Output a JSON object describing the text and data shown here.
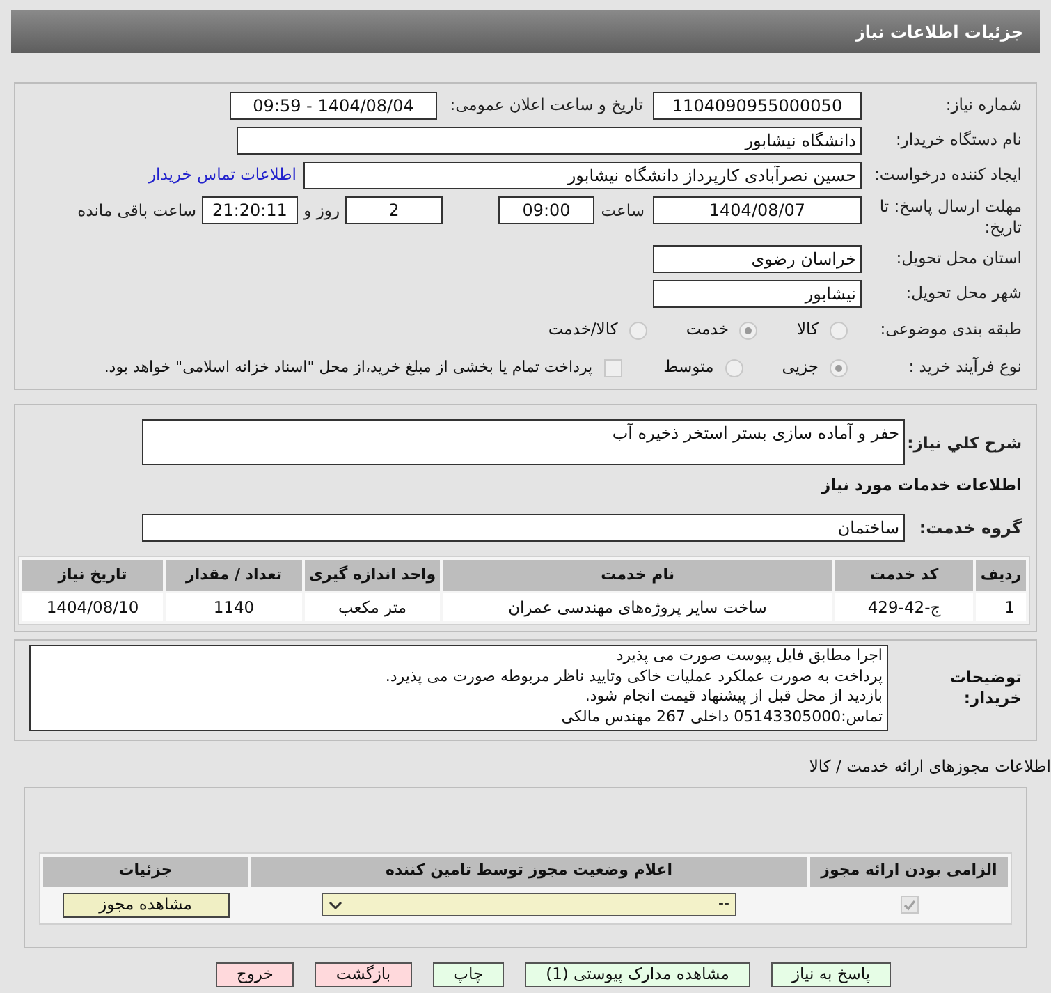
{
  "header": {
    "title": "جزئیات اطلاعات نیاز"
  },
  "need_number": {
    "label": "شماره نیاز:",
    "value": "1104090955000050"
  },
  "announce": {
    "label": "تاریخ و ساعت اعلان عمومی:",
    "value": "1404/08/04 - 09:59"
  },
  "buyer_org": {
    "label": "نام دستگاه خریدار:",
    "value": "دانشگاه نیشابور"
  },
  "requester": {
    "label": "ایجاد کننده درخواست:",
    "value": "حسین نصرآبادی کارپرداز دانشگاه نیشابور",
    "link": "اطلاعات تماس خریدار"
  },
  "deadline": {
    "label": "مهلت ارسال پاسخ: تا تاریخ:",
    "date": "1404/08/07",
    "time_label": "ساعت",
    "time": "09:00",
    "days": "2",
    "days_label": "روز و",
    "remaining": "21:20:11",
    "remaining_label": "ساعت باقی مانده"
  },
  "province": {
    "label": "استان محل تحویل:",
    "value": "خراسان رضوی"
  },
  "city": {
    "label": "شهر محل تحویل:",
    "value": "نیشابور"
  },
  "category": {
    "label": "طبقه بندی موضوعی:",
    "options": [
      {
        "label": "کالا",
        "selected": false
      },
      {
        "label": "خدمت",
        "selected": true
      },
      {
        "label": "کالا/خدمت",
        "selected": false
      }
    ]
  },
  "purchase_type": {
    "label": "نوع فرآیند خرید :",
    "options": [
      {
        "label": "جزیی",
        "selected": true
      },
      {
        "label": "متوسط",
        "selected": false
      }
    ],
    "payment": {
      "label": "پرداخت تمام یا بخشی از مبلغ خرید،از محل \"اسناد خزانه اسلامی\" خواهد بود.",
      "checked": false
    }
  },
  "summary": {
    "label": "شرح کلي نياز:",
    "value": "حفر و آماده سازی بستر استخر ذخیره آب"
  },
  "services_title": "اطلاعات خدمات مورد نیاز",
  "service_group": {
    "label": "گروه خدمت:",
    "value": "ساختمان"
  },
  "services_table": {
    "columns": [
      "ردیف",
      "کد خدمت",
      "نام خدمت",
      "واحد اندازه گیری",
      "تعداد / مقدار",
      "تاریخ نیاز"
    ],
    "rows": [
      [
        "1",
        "ج-42-429",
        "ساخت سایر پروژه‌های مهندسی عمران",
        "متر مکعب",
        "1140",
        "1404/08/10"
      ]
    ]
  },
  "buyer_notes": {
    "label": "توضیحات خریدار:",
    "lines": [
      "اجرا مطابق فایل پیوست صورت می پذیرد",
      "پرداخت به صورت عملکرد عملیات خاکی وتایید ناظر مربوطه صورت می پذیرد.",
      "بازدید از محل قبل از پیشنهاد قیمت انجام شود.",
      "تماس:05143305000 داخلی 267 مهندس مالکی"
    ]
  },
  "licenses": {
    "title": "اطلاعات مجوزهای ارائه خدمت / کالا",
    "columns": [
      "الزامی بودن ارائه مجوز",
      "اعلام وضعیت مجوز توسط تامین کننده",
      "جزئیات"
    ],
    "rows": [
      {
        "required": true,
        "status": "--",
        "action": "مشاهده مجوز"
      }
    ]
  },
  "buttons": [
    {
      "label": "پاسخ به نیاز",
      "kind": "normal"
    },
    {
      "label": "مشاهده مدارک پیوستی (1)",
      "kind": "normal"
    },
    {
      "label": "چاپ",
      "kind": "normal"
    },
    {
      "label": "بازگشت",
      "kind": "danger"
    },
    {
      "label": "خروج",
      "kind": "danger"
    }
  ]
}
